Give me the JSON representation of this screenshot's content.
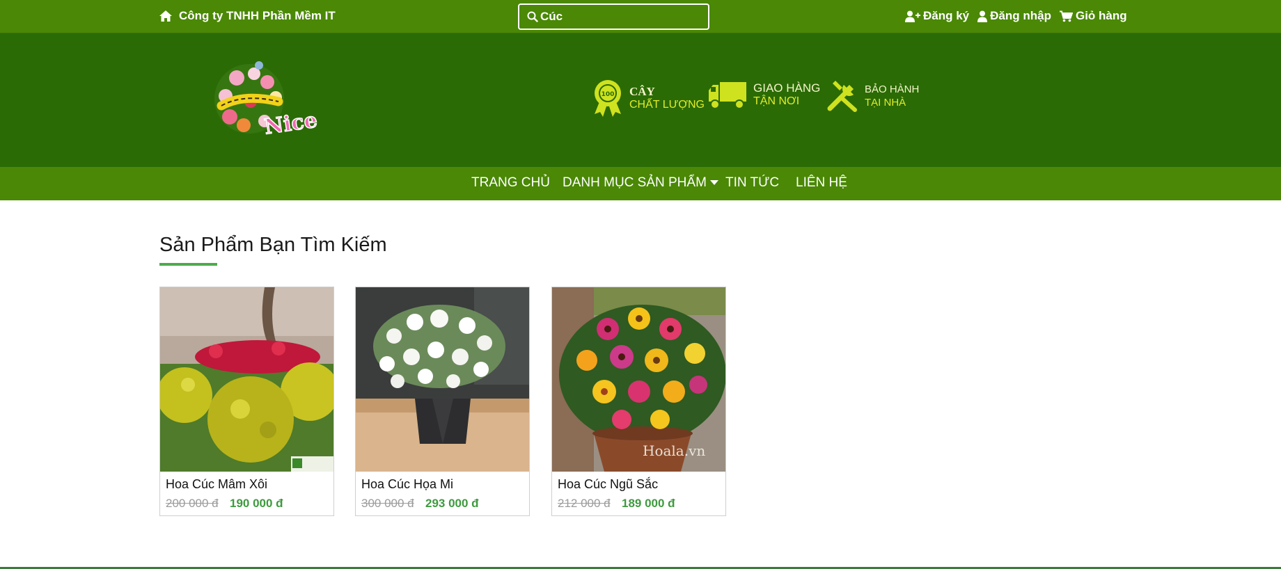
{
  "topbar": {
    "company": "Công ty TNHH Phần Mềm IT",
    "search_value": "Cúc",
    "register": "Đăng ký",
    "login": "Đăng nhập",
    "cart": "Giỏ hàng"
  },
  "header": {
    "logo_text": "Nice",
    "features": [
      {
        "line1": "CÂY",
        "line2": "CHẤT LƯỢNG",
        "icon": "quality-badge-icon"
      },
      {
        "line1": "GIAO HÀNG",
        "line2": "TẬN NƠI",
        "icon": "delivery-truck-icon"
      },
      {
        "line1": "BẢO HÀNH",
        "line2": "TẠI NHÀ",
        "icon": "tools-icon"
      }
    ]
  },
  "nav": {
    "items": [
      "TRANG CHỦ",
      "DANH MỤC SẢN PHẨM",
      "TIN TỨC",
      "LIÊN HỆ"
    ]
  },
  "main": {
    "title": "Sản Phẩm Bạn Tìm Kiếm",
    "products": [
      {
        "name": "Hoa Cúc Mâm Xôi",
        "old_price": "200 000 đ",
        "new_price": "190 000 đ"
      },
      {
        "name": "Hoa Cúc Họa Mi",
        "old_price": "300 000 đ",
        "new_price": "293 000 đ"
      },
      {
        "name": "Hoa Cúc Ngũ Sắc",
        "old_price": "212 000 đ",
        "new_price": "189 000 đ",
        "watermark": "Hoala.vn"
      }
    ]
  },
  "colors": {
    "topbar": "#4a8805",
    "header": "#2a6b06",
    "accent_yellow": "#e1ec2a",
    "price_green": "#3e9a3e"
  }
}
